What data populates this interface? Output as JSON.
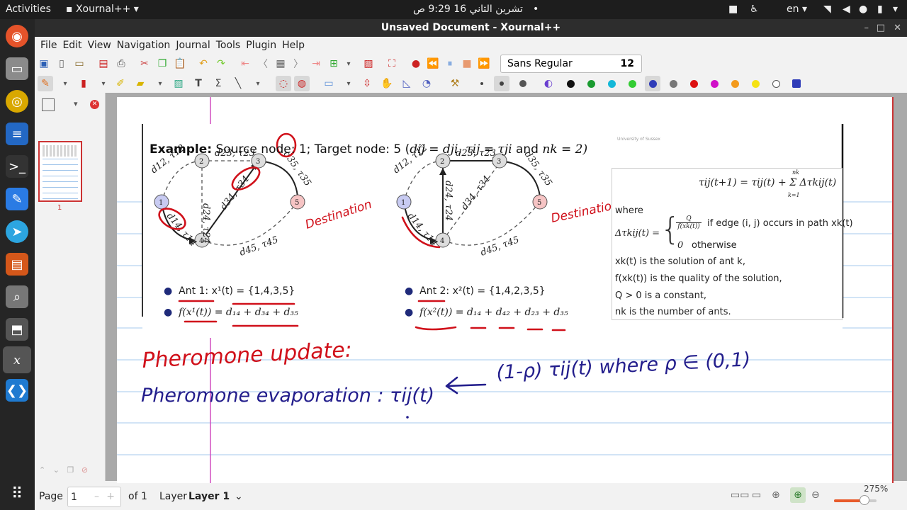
{
  "topbar": {
    "activities": "Activities",
    "app_name": "Xournal++",
    "clock": "تشرين الثاني 16  9:29 ص",
    "lang": "en"
  },
  "window": {
    "title": "Unsaved Document - Xournal++"
  },
  "menu": [
    "File",
    "Edit",
    "View",
    "Navigation",
    "Journal",
    "Tools",
    "Plugin",
    "Help"
  ],
  "toolbar": {
    "font_name": "Sans Regular",
    "font_size": "12",
    "colors": [
      "#111111",
      "#1a9b30",
      "#14b8d8",
      "#33cc33",
      "#2f3cb8",
      "#777777",
      "#dd1111",
      "#d010c8",
      "#f39a1c",
      "#f5e213",
      "#ffffff",
      "#2f3cb8"
    ]
  },
  "sidebar": {
    "page_number": "1"
  },
  "slide": {
    "example_bold": "Example:",
    "example_rest": "Source node: 1; Target node: 5 (",
    "example_math": "dij = dji, τij = τji",
    "example_and": "and",
    "example_nk": "nk = 2)",
    "faded": "University of Sussex",
    "ant1": "Ant 1: x¹(t) = {1,4,3,5}",
    "ant1_f": "f(x¹(t)) = d₁₄ + d₃₄ + d₃₅",
    "ant2": "Ant 2: x²(t) = {1,4,2,3,5}",
    "ant2_f": "f(x²(t)) = d₁₄ + d₄₂ + d₂₃ + d₃₅",
    "formula": "τij(t+1) = τij(t) + Σ Δτkij(t)",
    "sum_top": "nk",
    "sum_bottom": "k=1",
    "where": "where",
    "delta_lhs": "Δτkij(t) =",
    "case1_frac_num": "Q",
    "case1_frac_den": "f(xk(t))",
    "case1_text": "if edge (i, j) occurs in path xk(t)",
    "case2_val": "0",
    "case2_text": "otherwise",
    "line1": "xk(t) is the solution of ant k,",
    "line2": "f(xk(t)) is the quality of the solution,",
    "line3": "Q > 0 is a constant,",
    "line4": "nk is the number of ants."
  },
  "graph_labels": {
    "n1": "1",
    "n2": "2",
    "n3": "3",
    "n4": "4",
    "n5": "5",
    "e12": "d12, τ12",
    "e23": "d23, τ23",
    "e24": "d24, τ24",
    "e34": "d34, τ34",
    "e35": "d35, τ35",
    "e14": "d14, τ14",
    "e45": "d45, τ45"
  },
  "handwriting": {
    "destination_1": "Destination",
    "destination_2": "Destination",
    "line1": "Pheromone update:",
    "line2_left": "Pheromone evaporation :  τij(t)",
    "line2_right": "(1-ρ) τij(t)  where  ρ ∈ (0,1)"
  },
  "status": {
    "page_label": "Page",
    "page_value": "1",
    "of_label": "of 1",
    "layer_label": "Layer",
    "layer_value": "Layer 1",
    "zoom": "275%"
  }
}
